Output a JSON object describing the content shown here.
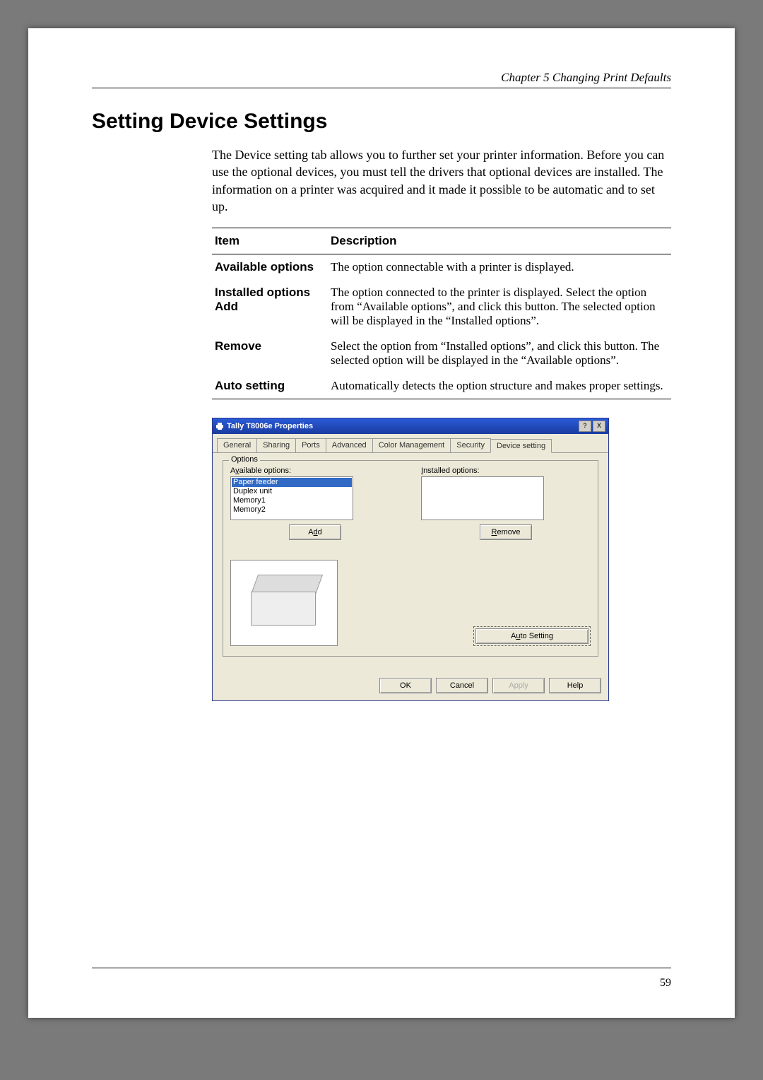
{
  "chapter_header": "Chapter 5 Changing Print Defaults",
  "section_title": "Setting Device Settings",
  "intro": "The Device setting tab allows you to further set your printer information. Before you can use the optional devices, you must tell the drivers that optional devices are installed. The information on a printer was acquired and it made it possible to be automatic and to set up.",
  "table": {
    "head_item": "Item",
    "head_desc": "Description",
    "rows": [
      {
        "item": "Available options",
        "desc": "The option connectable with a printer is displayed."
      },
      {
        "item": "Installed options Add",
        "desc": "The option connected to the printer is displayed. Select the option from “Available options”, and click this button. The selected option will be displayed in the “Installed options”."
      },
      {
        "item": "Remove",
        "desc": "Select the option from “Installed options”, and click this button. The selected option will be displayed in the “Available options”."
      },
      {
        "item": "Auto setting",
        "desc": "Automatically detects the option structure and makes proper settings."
      }
    ]
  },
  "dialog": {
    "title": "Tally T8006e Properties",
    "tabs": [
      "General",
      "Sharing",
      "Ports",
      "Advanced",
      "Color Management",
      "Security",
      "Device setting"
    ],
    "active_tab": "Device setting",
    "group_label": "Options",
    "available_label": "Available options:",
    "installed_label": "Installed options:",
    "available_items": [
      "Paper feeder",
      "Duplex unit",
      "Memory1",
      "Memory2"
    ],
    "selected_available": "Paper feeder",
    "add_btn": "Add",
    "remove_btn": "Remove",
    "auto_btn": "Auto Setting",
    "ok": "OK",
    "cancel": "Cancel",
    "apply": "Apply",
    "help": "Help",
    "winbtn_help": "?",
    "winbtn_close": "X"
  },
  "page_number": "59"
}
